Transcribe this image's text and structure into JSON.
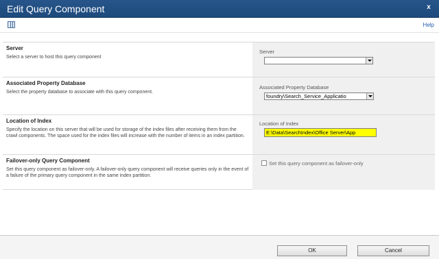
{
  "window": {
    "title": "Edit Query Component",
    "close_label": "x"
  },
  "toolbar": {
    "help_label": "Help",
    "icon": "columns-icon"
  },
  "sections": {
    "server": {
      "title": "Server",
      "description": "Select a server to host this query component",
      "field_label": "Server",
      "value": ""
    },
    "property_db": {
      "title": "Associated Property Database",
      "description": "Select the property database to associate with this query component.",
      "field_label": "Associated Property Database",
      "value": "foundry\\Search_Service_Applicatio"
    },
    "location": {
      "title": "Location of Index",
      "description": "Specify the location on this server that will be used for storage of the index files after receiving them from the crawl components. The space used for the index files will increase with the number of items in an index partition.",
      "field_label": "Location of Index",
      "value": "E:\\Data\\SearchIndex\\Office Server\\App"
    },
    "failover": {
      "title": "Failover-only Query Component",
      "description": "Set this query component as failover-only. A failover-only query component will receive queries only in the event of a failure of the primary query component in the same index partition.",
      "checkbox_label": "Set this query component as failover-only",
      "checked": false
    }
  },
  "buttons": {
    "ok": "OK",
    "cancel": "Cancel"
  },
  "colors": {
    "titlebar": "#27558a",
    "highlight": "#ffff00",
    "panel": "#f0f0f0"
  }
}
